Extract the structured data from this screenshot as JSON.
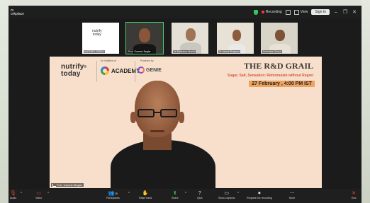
{
  "window": {
    "title_line1": "m",
    "title_line2": "orkplace"
  },
  "titlebar": {
    "recording_label": "Recording",
    "view_label": "View",
    "signin_label": "Sign In",
    "minimize": "–",
    "restore": "❐",
    "close": "✕"
  },
  "participants": [
    {
      "name": "NUTRIFY TODAY"
    },
    {
      "name": "Prof. Ganesh Bagler"
    },
    {
      "name": "Dr Balkumar Marthi"
    },
    {
      "name": "Dr Ashok Bhagwat"
    },
    {
      "name": "Subhasis Ghosh"
    }
  ],
  "slide": {
    "brand_line1": "nutrify",
    "brand_line2": "today",
    "brand_reg": "®",
    "initiative_label": "An initiative of",
    "academy_name": "ACADEMY",
    "powered_label": "Powered by",
    "genie_name": "GENIE",
    "title": "THE R&D GRAIL",
    "subtitle": "Sugar, Salt, Sensation: Reformulate without Regret",
    "date": "27 February , 4:00 PM IST"
  },
  "speaker": {
    "name": "Prof. Ganesh Bagler"
  },
  "toolbar": {
    "audio": "Audio",
    "video": "Video",
    "participants": "Participants",
    "participants_count": "29",
    "raise_hand": "Raise hand",
    "share": "Share",
    "qa": "Q&A",
    "show_captions": "Show captions",
    "recording_req": "Request live recording",
    "more": "More",
    "end": "End"
  },
  "colors": {
    "accent_green": "#34c759",
    "record_red": "#ff3b30",
    "slide_bg": "#f7dfcb",
    "date_bg": "#f0a35f",
    "subtitle_red": "#d4573c"
  }
}
